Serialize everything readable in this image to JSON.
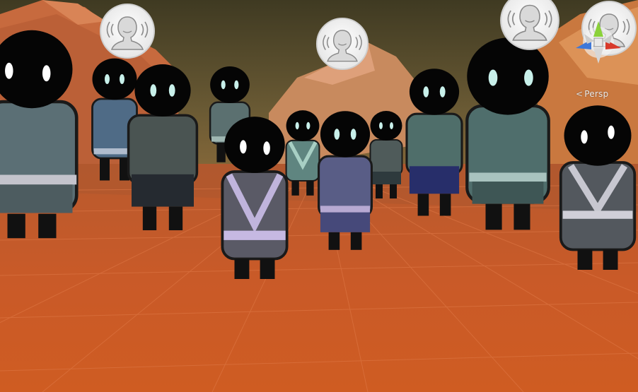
{
  "scene_view": {
    "camera_mode_label": "Persp",
    "camera_mode_glyph": "<"
  },
  "icons": {
    "gizmo": "axis-gizmo-icon",
    "speech": "speaking-person-bubble-icon"
  },
  "colors": {
    "ground": "#c9582a",
    "sky": "#5c5230",
    "character_head": "#050505",
    "character_eyes": "#c8f0ea"
  }
}
